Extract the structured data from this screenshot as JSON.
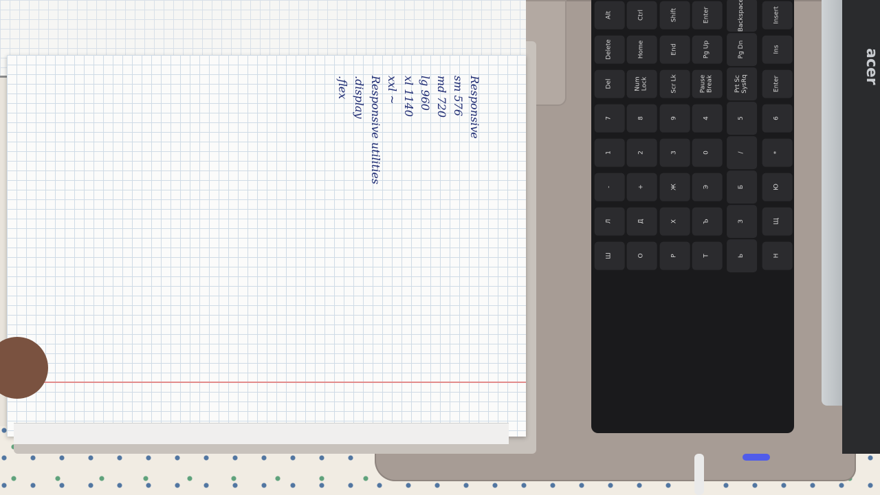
{
  "laptop": {
    "brand_text": "acer",
    "keys": [
      "Alt",
      "Ctrl",
      "Shift",
      "Enter",
      "Backspace",
      "Insert",
      "Delete",
      "Home",
      "End",
      "Pg Up",
      "Pg Dn",
      "Ins",
      "Del",
      "Num Lock",
      "Scr Lk",
      "Pause Break",
      "Prt Sc SysRq",
      "Enter",
      "7",
      "8",
      "9",
      "4",
      "5",
      "6",
      "1",
      "2",
      "3",
      "0",
      "/",
      "*",
      "-",
      "+",
      "Ж",
      "Э",
      "Б",
      "Ю",
      "Л",
      "Д",
      "Х",
      "Ъ",
      "З",
      "Щ",
      "Ш",
      "О",
      "Р",
      "Т",
      "Ь",
      "Н"
    ]
  },
  "notebook": {
    "handwritten_lines": [
      "Responsive",
      "sm   576",
      "md   720",
      "lg   960",
      "xl   1140",
      "xxl  ~",
      "Responsive utilities",
      ".display",
      ".flex"
    ]
  },
  "colors": {
    "ink": "#1d2a72",
    "grid": "#cfdbe6",
    "margin": "#e28b8b",
    "laptop": "#a79c95",
    "keyboard": "#1a1a1c"
  }
}
